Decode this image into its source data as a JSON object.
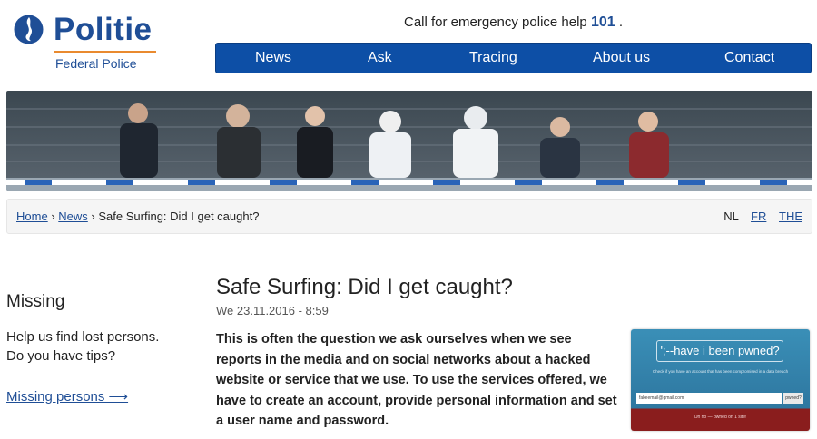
{
  "header": {
    "logo_word": "Politie",
    "logo_sub": "Federal Police",
    "emergency_text": "Call for emergency police help",
    "emergency_number": "101",
    "emergency_suffix": " ."
  },
  "nav": {
    "items": [
      {
        "label": "News"
      },
      {
        "label": "Ask"
      },
      {
        "label": "Tracing"
      },
      {
        "label": "About us"
      },
      {
        "label": "Contact"
      }
    ]
  },
  "breadcrumb": {
    "home": "Home",
    "news": "News",
    "current": "Safe Surfing: Did I get caught?",
    "separator": "›"
  },
  "languages": {
    "nl": "NL",
    "fr": "FR",
    "the": "THE"
  },
  "sidebar": {
    "title": "Missing",
    "text_line1": "Help us find lost persons.",
    "text_line2": "Do you have tips?",
    "link": "Missing persons ⟶"
  },
  "article": {
    "title": "Safe Surfing: Did I get caught?",
    "date": "We 23.11.2016 - 8:59",
    "lead": "This is often the question we ask ourselves when we see reports in the media and on social networks about a hacked website or service that we use. To use the services offered, we have to create an account, provide personal information and set a user name and password."
  },
  "thumbnail": {
    "title": "';--have i been pwned?",
    "subtitle": "Check if you have an account that has been compromised in a data breach",
    "input_value": "fakeemail@gmail.com",
    "button": "pwned?",
    "footer": "Oh no — pwned on 1 site!"
  },
  "colors": {
    "brand_blue": "#1f4e96",
    "nav_blue": "#0d4fa6",
    "accent_orange": "#e98a2f"
  }
}
